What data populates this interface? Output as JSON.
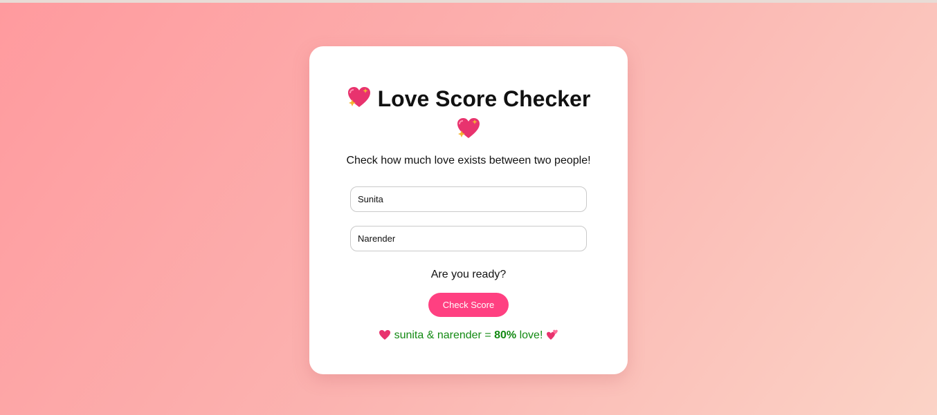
{
  "app": {
    "title": "Love Score Checker",
    "subtitle": "Check how much love exists between two people!",
    "title_icon": "sparkling-heart-icon"
  },
  "form": {
    "name1_value": "Sunita",
    "name2_value": "Narender",
    "ready_text": "Are you ready?",
    "button_label": "Check Score"
  },
  "result": {
    "prefix": "sunita & narender = ",
    "score": "80%",
    "suffix": " love!",
    "icon_left": "heart-icon",
    "icon_right": "two-hearts-icon"
  },
  "colors": {
    "accent": "#ff4081",
    "result_text": "#138a13"
  }
}
